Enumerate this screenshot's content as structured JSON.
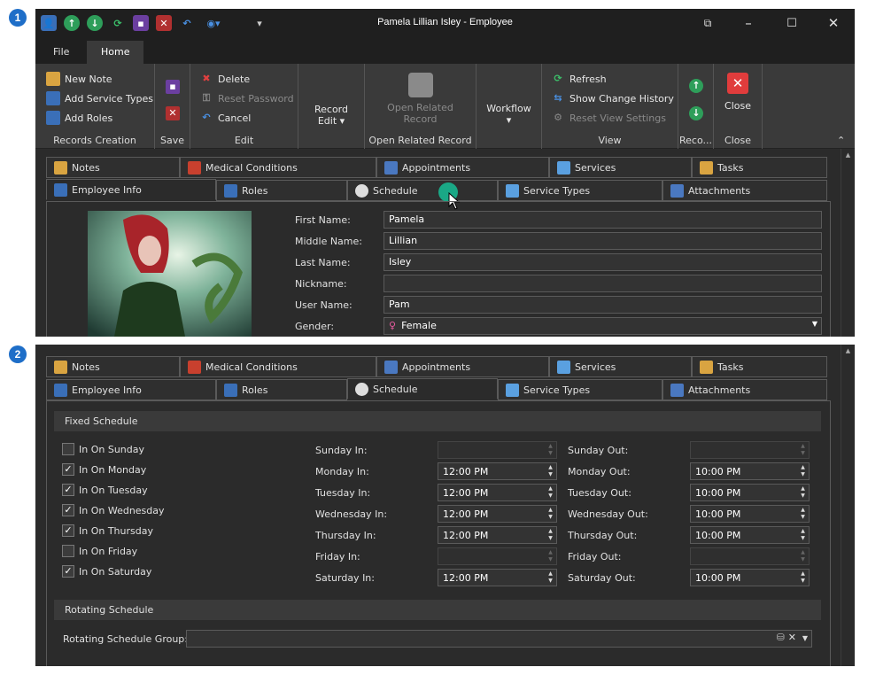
{
  "badges": [
    "1",
    "2"
  ],
  "window": {
    "title": "Pamela Lillian Isley - Employee"
  },
  "menu": {
    "file": "File",
    "home": "Home"
  },
  "ribbon": {
    "records_creation": {
      "new_note": "New Note",
      "add_service_types": "Add Service Types",
      "add_roles": "Add Roles",
      "label": "Records Creation"
    },
    "save": {
      "label": "Save"
    },
    "edit": {
      "delete": "Delete",
      "reset_password": "Reset Password",
      "cancel": "Cancel",
      "label": "Edit"
    },
    "record_edit": {
      "line1": "Record",
      "line2": "Edit ▾"
    },
    "open_related": {
      "line1": "Open Related",
      "line2": "Record",
      "label": "Open Related Record"
    },
    "workflow": {
      "label": "Workflow",
      "arrow": "▾"
    },
    "view": {
      "refresh": "Refresh",
      "show_change_history": "Show Change History",
      "reset_view_settings": "Reset View Settings",
      "label": "View"
    },
    "reco": {
      "label": "Reco..."
    },
    "close": {
      "button": "Close",
      "label": "Close"
    }
  },
  "tabs": {
    "notes": "Notes",
    "medical_conditions": "Medical Conditions",
    "appointments": "Appointments",
    "services": "Services",
    "tasks": "Tasks",
    "employee_info": "Employee Info",
    "roles": "Roles",
    "schedule": "Schedule",
    "service_types": "Service Types",
    "attachments": "Attachments"
  },
  "employee": {
    "first_name_label": "First Name:",
    "first_name": "Pamela",
    "middle_name_label": "Middle Name:",
    "middle_name": "Lillian",
    "last_name_label": "Last Name:",
    "last_name": "Isley",
    "nickname_label": "Nickname:",
    "nickname": "",
    "user_name_label": "User Name:",
    "user_name": "Pam",
    "gender_label": "Gender:",
    "gender": "Female"
  },
  "schedule": {
    "fixed_title": "Fixed Schedule",
    "rotating_title": "Rotating Schedule",
    "rotating_group_label": "Rotating Schedule Group:",
    "days": [
      {
        "check": "In On Sunday",
        "checked": false,
        "in_label": "Sunday In:",
        "in": "",
        "out_label": "Sunday Out:",
        "out": ""
      },
      {
        "check": "In On Monday",
        "checked": true,
        "in_label": "Monday In:",
        "in": "12:00 PM",
        "out_label": "Monday Out:",
        "out": "10:00 PM"
      },
      {
        "check": "In On Tuesday",
        "checked": true,
        "in_label": "Tuesday In:",
        "in": "12:00 PM",
        "out_label": "Tuesday Out:",
        "out": "10:00 PM"
      },
      {
        "check": "In On Wednesday",
        "checked": true,
        "in_label": "Wednesday In:",
        "in": "12:00 PM",
        "out_label": "Wednesday Out:",
        "out": "10:00 PM"
      },
      {
        "check": "In On Thursday",
        "checked": true,
        "in_label": "Thursday In:",
        "in": "12:00 PM",
        "out_label": "Thursday Out:",
        "out": "10:00 PM"
      },
      {
        "check": "In On Friday",
        "checked": false,
        "in_label": "Friday In:",
        "in": "",
        "out_label": "Friday Out:",
        "out": ""
      },
      {
        "check": "In On Saturday",
        "checked": true,
        "in_label": "Saturday In:",
        "in": "12:00 PM",
        "out_label": "Saturday Out:",
        "out": "10:00 PM"
      }
    ]
  }
}
